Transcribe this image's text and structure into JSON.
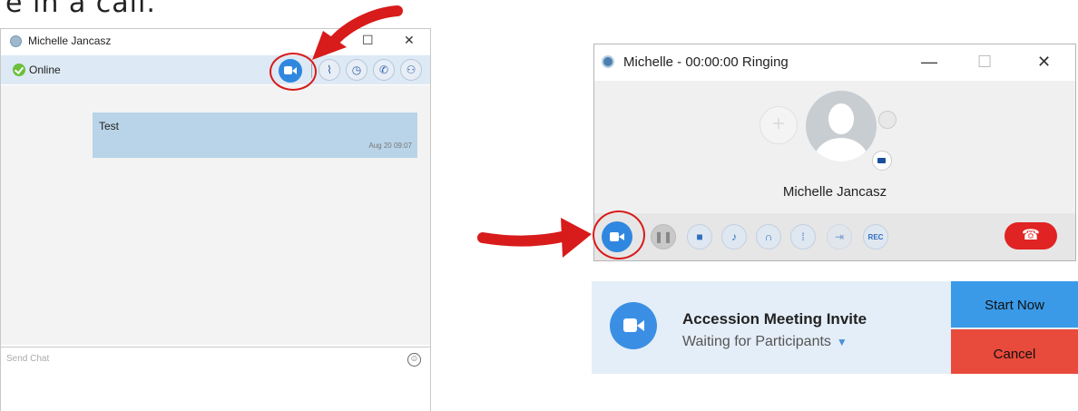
{
  "caption": "e in a call.",
  "chat_window": {
    "title": "Michelle Jancasz",
    "status": "Online",
    "message": {
      "text": "Test",
      "time": "Aug 20 09:07"
    },
    "send_placeholder": "Send Chat"
  },
  "call_window": {
    "title": "Michelle - 00:00:00 Ringing",
    "callee_name": "Michelle Jancasz",
    "record_label": "REC"
  },
  "invite": {
    "title": "Accession Meeting Invite",
    "subtitle": "Waiting for Participants",
    "start_label": "Start Now",
    "cancel_label": "Cancel"
  },
  "icons": {
    "window_min": "minimize-icon",
    "window_max": "maximize-icon",
    "window_close": "close-icon"
  },
  "colors": {
    "accent_blue": "#2f87df",
    "hangup_red": "#e02323",
    "start_blue": "#3a9ae8",
    "cancel_red": "#e84a3b",
    "annotation_red": "#d81b1b"
  }
}
